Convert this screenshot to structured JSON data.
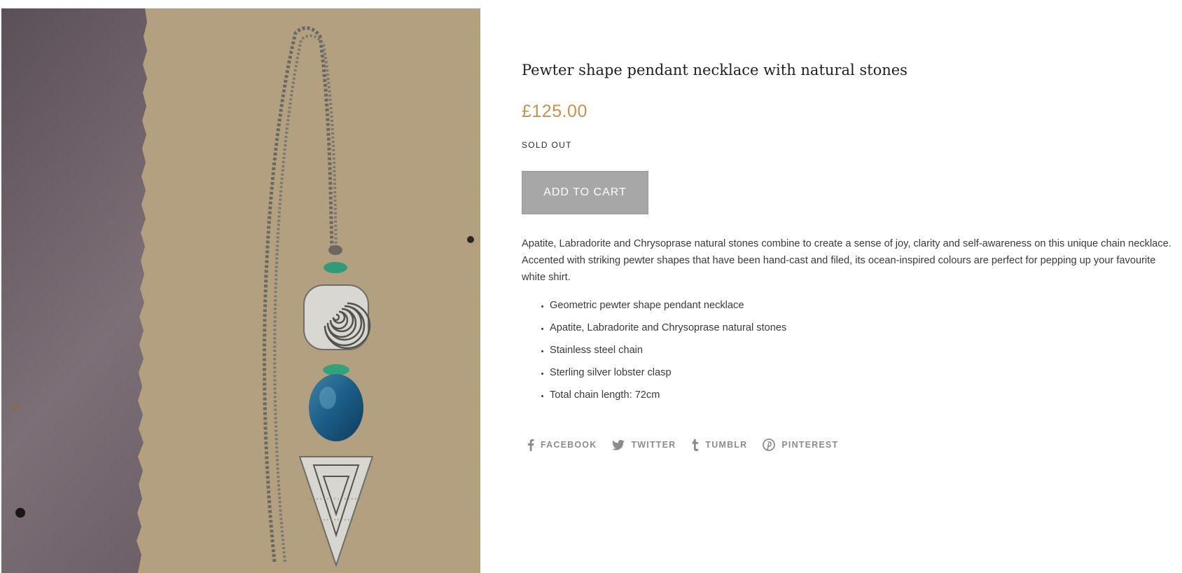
{
  "product": {
    "title": "Pewter shape pendant necklace with natural stones",
    "price": "£125.00",
    "stock_status": "SOLD OUT",
    "add_to_cart_label": "ADD TO CART",
    "description": "Apatite, Labradorite and Chrysoprase natural stones combine to create a sense of joy, clarity and self-awareness on this unique chain necklace. Accented with striking pewter shapes that have been hand-cast and filed, its ocean-inspired colours are perfect for pepping up your favourite white shirt.",
    "features": [
      "Geometric pewter shape pendant necklace",
      "Apatite, Labradorite and Chrysoprase natural stones",
      "Stainless steel chain",
      "Sterling silver lobster clasp",
      "Total chain length: 72cm"
    ],
    "image_alt": "Pewter pendant necklace with spiral square, blue oval stone and triangle on kraft paper"
  },
  "share": [
    {
      "label": "FACEBOOK",
      "icon": "facebook-icon"
    },
    {
      "label": "TWITTER",
      "icon": "twitter-icon"
    },
    {
      "label": "TUMBLR",
      "icon": "tumblr-icon"
    },
    {
      "label": "PINTEREST",
      "icon": "pinterest-icon"
    }
  ],
  "colors": {
    "price": "#c9904f",
    "button": "#a7a7a7",
    "share": "#8c8c8c"
  }
}
